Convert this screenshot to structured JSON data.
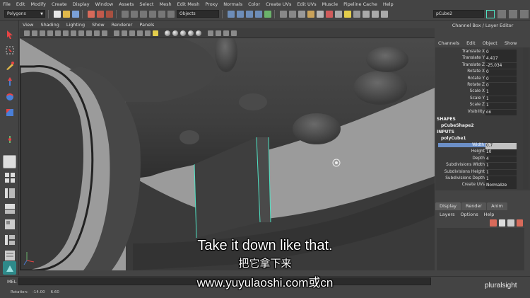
{
  "menu": [
    "File",
    "Edit",
    "Modify",
    "Create",
    "Display",
    "Window",
    "Assets",
    "Select",
    "Mesh",
    "Edit Mesh",
    "Proxy",
    "Normals",
    "Color",
    "Create UVs",
    "Edit UVs",
    "Muscle",
    "Pipeline Cache",
    "Help"
  ],
  "status_line": {
    "menu_set": "Polygons",
    "objects_field": "Objects",
    "name_field": "pCube2"
  },
  "panel_menu": [
    "View",
    "Shading",
    "Lighting",
    "Show",
    "Renderer",
    "Panels"
  ],
  "channel_box": {
    "title": "Channel Box / Layer Editor",
    "tabs": [
      "Channels",
      "Edit",
      "Object",
      "Show"
    ],
    "transform_attrs": [
      {
        "label": "Translate X",
        "value": "0"
      },
      {
        "label": "Translate Y",
        "value": "4.417"
      },
      {
        "label": "Translate Z",
        "value": "-25.034"
      },
      {
        "label": "Rotate X",
        "value": "0"
      },
      {
        "label": "Rotate Y",
        "value": "0"
      },
      {
        "label": "Rotate Z",
        "value": "0"
      },
      {
        "label": "Scale X",
        "value": "1"
      },
      {
        "label": "Scale Y",
        "value": "1"
      },
      {
        "label": "Scale Z",
        "value": "1"
      },
      {
        "label": "Visibility",
        "value": "on"
      }
    ],
    "shapes_header": "SHAPES",
    "shape_name": "pCubeShape2",
    "inputs_header": "INPUTS",
    "input_name": "polyCube1",
    "input_attrs": [
      {
        "label": "Width",
        "value": "0.7"
      },
      {
        "label": "Height",
        "value": "10"
      },
      {
        "label": "Depth",
        "value": "4"
      },
      {
        "label": "Subdivisions Width",
        "value": "1"
      },
      {
        "label": "Subdivisions Height",
        "value": "1"
      },
      {
        "label": "Subdivisions Depth",
        "value": "1"
      },
      {
        "label": "Create UVs",
        "value": "Normalize"
      }
    ]
  },
  "layer_editor": {
    "tabs": [
      "Display",
      "Render",
      "Anim"
    ],
    "menu": [
      "Layers",
      "Options",
      "Help"
    ]
  },
  "command_line": {
    "label": "MEL"
  },
  "help_line": {
    "rotation_label": "Rotation:",
    "rotation_x": "-14.00",
    "rotation_y": "6.60"
  },
  "subtitles": {
    "english": "Take it down like that.",
    "chinese": "把它拿下来",
    "url": "www.yuyulaoshi.com或cn"
  },
  "watermark": "pluralsight",
  "colors": {
    "selection_blue": "#6c8fc7",
    "edge_highlight": "#4fe3c4",
    "viewport_bg": "#9b9b9b"
  }
}
